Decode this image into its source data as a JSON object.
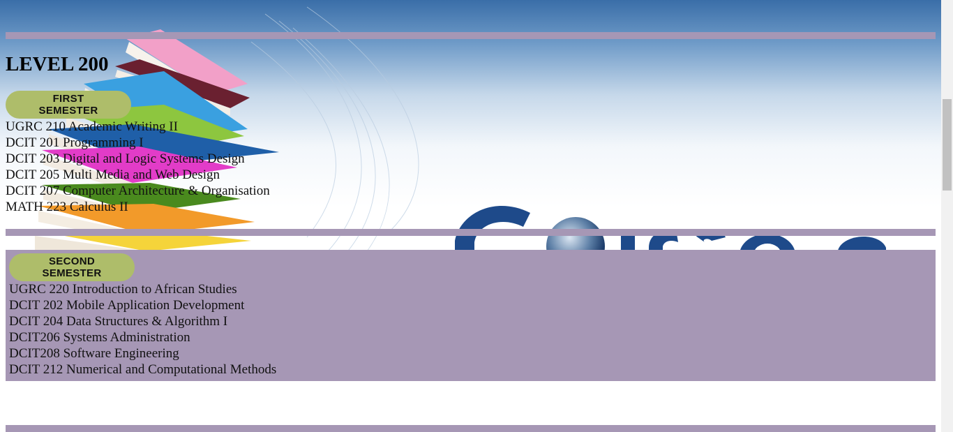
{
  "level": {
    "title": "LEVEL 200"
  },
  "first_semester": {
    "button_label": "FIRST SEMESTER",
    "courses": [
      "UGRC 210 Academic Writing II",
      "DCIT 201 Programming I",
      "DCIT 203 Digital and Logic Systems Design",
      "DCIT 205 Multi Media and Web Design",
      "DCIT 207 Computer Architecture & Organisation",
      "MATH 223 Calculus II"
    ]
  },
  "second_semester": {
    "button_label": "SECOND SEMESTER",
    "courses": [
      "UGRC 220 Introduction to African Studies",
      "DCIT 202 Mobile Application Development",
      "DCIT 204 Data Structures & Algorithm I",
      "DCIT206 Systems Administration",
      "DCIT208 Software Engineering",
      "DCIT 212 Numerical and Computational Methods"
    ]
  },
  "background": {
    "logo_text": "Courses"
  },
  "colors": {
    "rule": "#a697b5",
    "button": "#aebd6a"
  }
}
